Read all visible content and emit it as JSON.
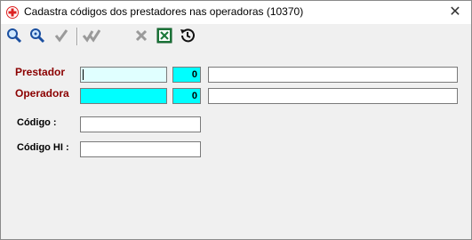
{
  "window": {
    "title": "Cadastra códigos dos prestadores nas operadoras (10370)",
    "close_symbol": "✕"
  },
  "toolbar": {
    "buttons": [
      {
        "name": "search-icon",
        "enabled": true
      },
      {
        "name": "search-advanced-icon",
        "enabled": true
      },
      {
        "name": "check-icon",
        "enabled": false
      },
      {
        "name": "check-all-icon",
        "enabled": false
      },
      {
        "name": "cancel-icon",
        "enabled": false
      },
      {
        "name": "excel-icon",
        "enabled": true
      },
      {
        "name": "history-icon",
        "enabled": true
      }
    ]
  },
  "form": {
    "prestador": {
      "label": "Prestador",
      "value": "",
      "code": "0",
      "description": ""
    },
    "operadora": {
      "label": "Operadora",
      "value": "",
      "code": "0",
      "description": ""
    },
    "codigo": {
      "label": "Código :",
      "value": ""
    },
    "codigo_hi": {
      "label": "Código HI :",
      "value": ""
    }
  },
  "colors": {
    "required_label": "#8b0000",
    "code_bg": "#00ffff",
    "active_bg": "#e0ffff"
  }
}
